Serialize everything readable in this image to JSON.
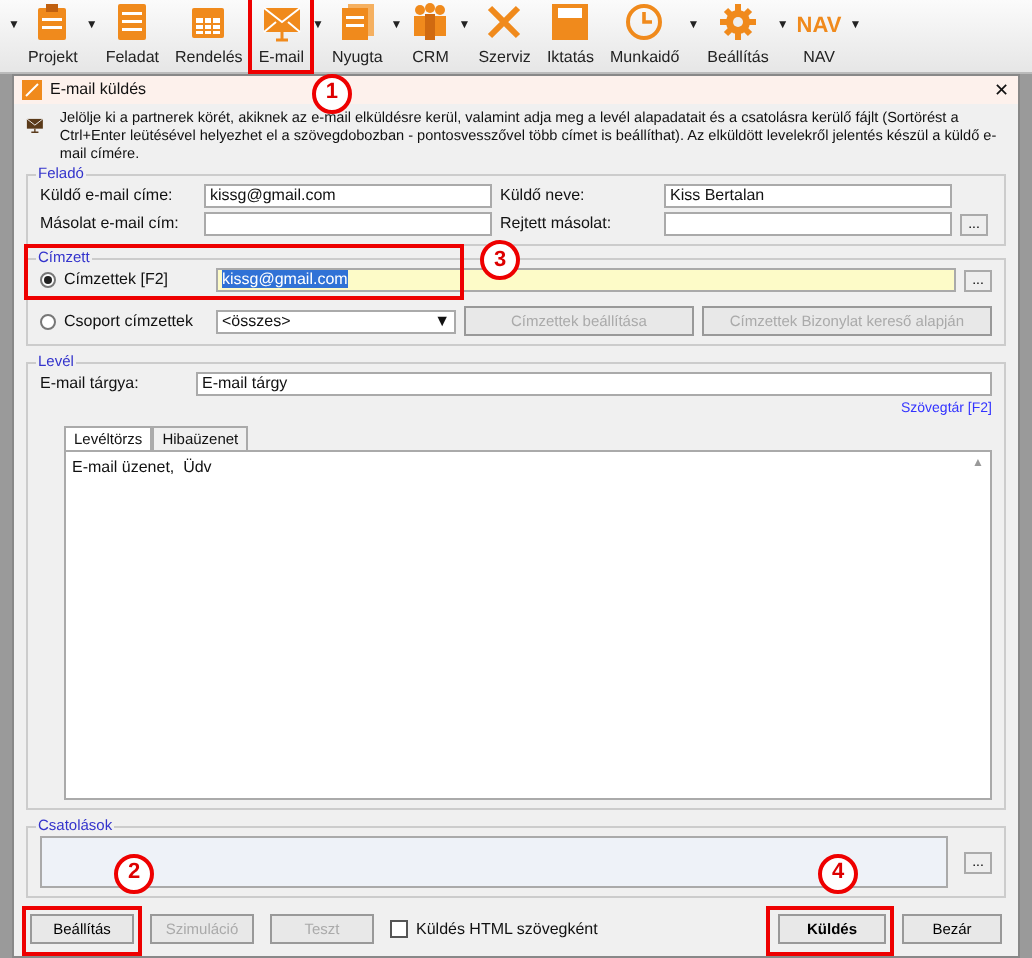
{
  "toolbar_lead_caret": "▼",
  "toolbar": [
    {
      "label": "Projekt",
      "caret": "▼",
      "highlighted": false
    },
    {
      "label": "Feladat",
      "highlighted": false
    },
    {
      "label": "Rendelés",
      "highlighted": false
    },
    {
      "label": "E-mail",
      "caret": "▼",
      "highlighted": true,
      "annotation": "1"
    },
    {
      "label": "Nyugta",
      "caret": "▼",
      "highlighted": false
    },
    {
      "label": "CRM",
      "caret": "▼",
      "highlighted": false
    },
    {
      "label": "Szerviz",
      "highlighted": false
    },
    {
      "label": "Iktatás",
      "highlighted": false
    },
    {
      "label": "Munkaidő",
      "caret": "▼",
      "highlighted": false
    },
    {
      "label": "Beállítás",
      "caret": "▼",
      "highlighted": false
    },
    {
      "label": "NAV",
      "logo": "NAV",
      "caret": "▼",
      "highlighted": false
    }
  ],
  "dialog": {
    "title": "E-mail küldés",
    "close": "✕",
    "description": "Jelölje ki a partnerek körét, akiknek az e-mail elküldésre kerül, valamint adja meg a levél alapadatait és a csatolásra kerülő fájlt (Sortörést a Ctrl+Enter leütésével helyezhet el a szövegdobozban - pontosvesszővel több címet is beállíthat). Az elküldött levelekről jelentés készül a küldő e-mail címére.",
    "sender": {
      "legend": "Feladó",
      "fields": [
        {
          "label": "Küldő e-mail címe:",
          "value": "kissg@gmail.com"
        },
        {
          "label": "Küldő neve:",
          "value": "Kiss Bertalan"
        },
        {
          "label": "Másolat e-mail cím:"
        },
        {
          "label": "Rejtett másolat:"
        }
      ],
      "browse": "..."
    },
    "recipient": {
      "legend": "Címzett",
      "annotation": "3",
      "options": [
        {
          "label": "Címzettek [F2]",
          "selected": true
        },
        {
          "label": "Csoport címzettek",
          "selected": false
        }
      ],
      "address": "kissg@gmail.com",
      "browse": "...",
      "group": "<összes>",
      "group_caret": "▼",
      "buttons": [
        {
          "label": "Címzettek beállítása",
          "disabled": true
        },
        {
          "label": "Címzettek Bizonylat kereső alapján",
          "disabled": true
        }
      ]
    },
    "letter": {
      "legend": "Levél",
      "subject_label": "E-mail tárgya:",
      "subject": "E-mail tárgy",
      "snippets_link": "Szövegtár [F2]",
      "tabs": [
        {
          "label": "Levéltörzs",
          "selected": true
        },
        {
          "label": "Hibaüzenet",
          "selected": false
        }
      ],
      "body": "E-mail üzenet,  Üdv",
      "scroll_up": "▲"
    },
    "attachments": {
      "legend": "Csatolások",
      "browse": "..."
    },
    "footer": {
      "buttons": [
        {
          "label": "Beállítás",
          "disabled": false,
          "annotation": "2"
        },
        {
          "label": "Szimuláció",
          "disabled": true
        },
        {
          "label": "Teszt",
          "disabled": true
        }
      ],
      "html_checkbox": {
        "label": "Küldés HTML szövegként",
        "checked": false
      },
      "actions": [
        {
          "label": "Küldés",
          "default": true,
          "annotation": "4"
        },
        {
          "label": "Bezár",
          "default": false
        }
      ]
    }
  }
}
